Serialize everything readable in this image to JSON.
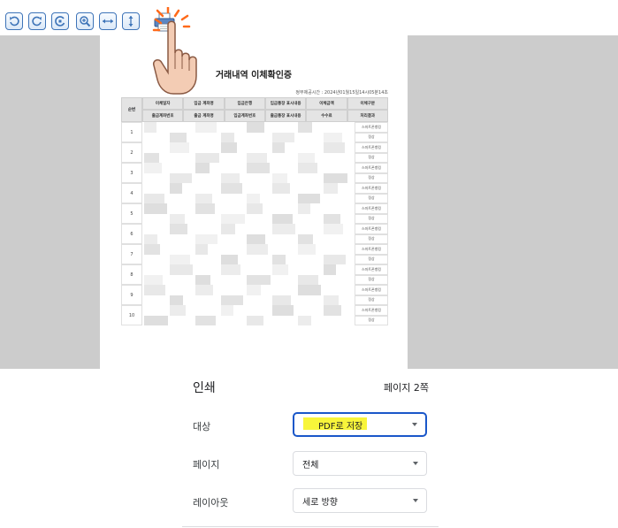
{
  "toolbar": {
    "buttons": [
      {
        "name": "rotate-left-icon"
      },
      {
        "name": "rotate-right-icon"
      },
      {
        "name": "refresh-icon"
      },
      {
        "name": "zoom-in-icon"
      },
      {
        "name": "fit-width-icon"
      },
      {
        "name": "fit-height-icon"
      },
      {
        "name": "print-icon"
      }
    ]
  },
  "preview": {
    "doc_title": "거래내역 이체확인증",
    "doc_meta": "정부제공시간 : 2024년01월15일14시05분14초",
    "header_row1": [
      "이체일자",
      "입금 계좌명",
      "입금은행",
      "입금통장 표시내용",
      "이체금액",
      "이체구분"
    ],
    "header_row2": [
      "출금계좌번호",
      "출금 계좌명",
      "입금계좌번호",
      "출금통장 표시내용",
      "수수료",
      "처리결과"
    ],
    "seq_header": "순번",
    "rows": [
      "1",
      "2",
      "3",
      "4",
      "5",
      "6",
      "7",
      "8",
      "9",
      "10"
    ],
    "result_labels": [
      "스마트폰뱅킹",
      "정상"
    ]
  },
  "print_panel": {
    "title": "인쇄",
    "page_count": "페이지 2쪽",
    "destination_label": "대상",
    "destination_value": "PDF로 저장",
    "pages_label": "페이지",
    "pages_value": "전체",
    "layout_label": "레이아웃",
    "layout_value": "세로 방향"
  },
  "colors": {
    "accent": "#1a57c9",
    "highlight": "#f8f53a",
    "preview_bg": "#cccccc",
    "toolbar_icon": "#3e74b8"
  }
}
